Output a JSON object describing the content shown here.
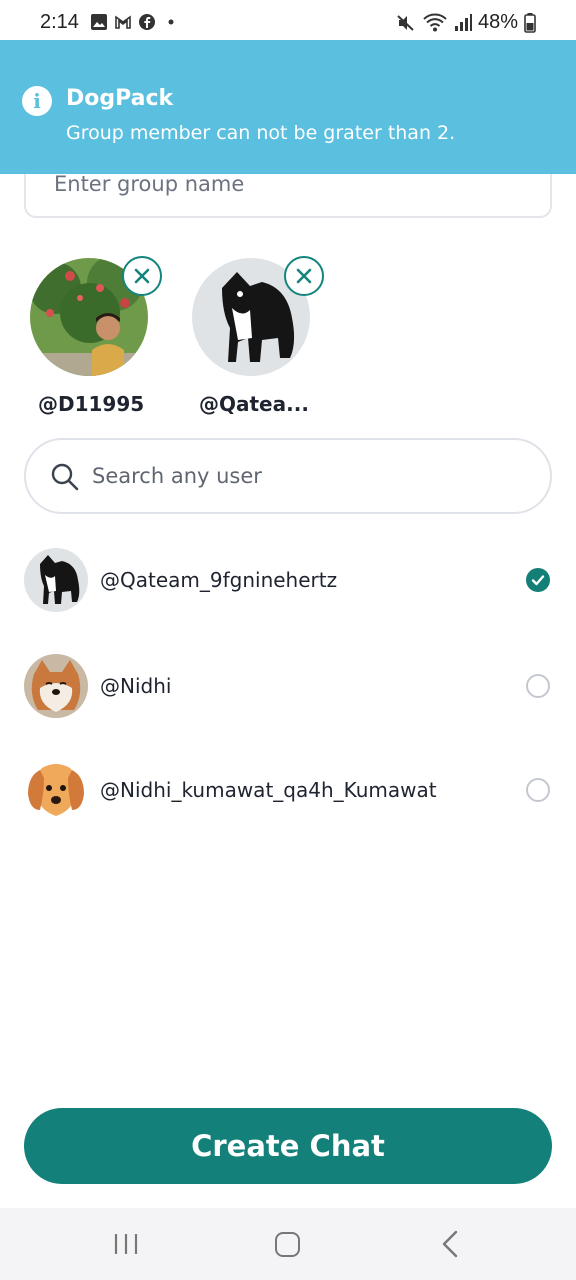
{
  "status_bar": {
    "time": "2:14",
    "battery": "48%"
  },
  "banner": {
    "title": "DogPack",
    "message": "Group member can not be grater than 2."
  },
  "group_name": {
    "placeholder": "Enter group name"
  },
  "selected_members": [
    {
      "username": "@D11995"
    },
    {
      "username": "@Qatea..."
    }
  ],
  "search": {
    "placeholder": "Search any user"
  },
  "users": [
    {
      "username": "@Qateam_9fgninehertz",
      "selected": true
    },
    {
      "username": "@Nidhi",
      "selected": false
    },
    {
      "username": "@Nidhi_kumawat_qa4h_Kumawat",
      "selected": false
    }
  ],
  "create_button": {
    "label": "Create Chat"
  },
  "colors": {
    "accent": "#13817a",
    "banner": "#5bbfdf"
  }
}
